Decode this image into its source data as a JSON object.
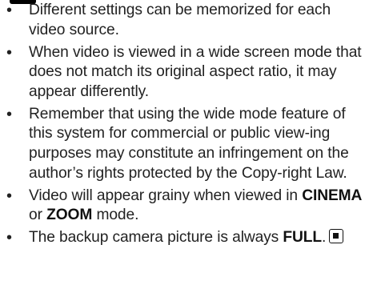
{
  "notes": [
    {
      "text": "Different settings can be memorized for each video source."
    },
    {
      "text": "When video is viewed in a wide screen mode that does not match its original aspect ratio, it may appear differently."
    },
    {
      "text": "Remember that using the wide mode feature of this system for commercial or public view-ing purposes may constitute an infringement on the author’s rights protected by the Copy-right Law."
    },
    {
      "text_before": "Video will appear grainy when viewed in ",
      "bold_1": "CINEMA",
      "text_mid": " or ",
      "bold_2": "ZOOM",
      "text_after": " mode."
    },
    {
      "text_before": "The backup camera picture is always ",
      "bold_1": "FULL",
      "text_after": "."
    }
  ],
  "bullet_symbol": "•",
  "end_icon": "section-end-icon",
  "colors": {
    "text": "#222222",
    "bold": "#111111",
    "header_bar": "#000000"
  }
}
